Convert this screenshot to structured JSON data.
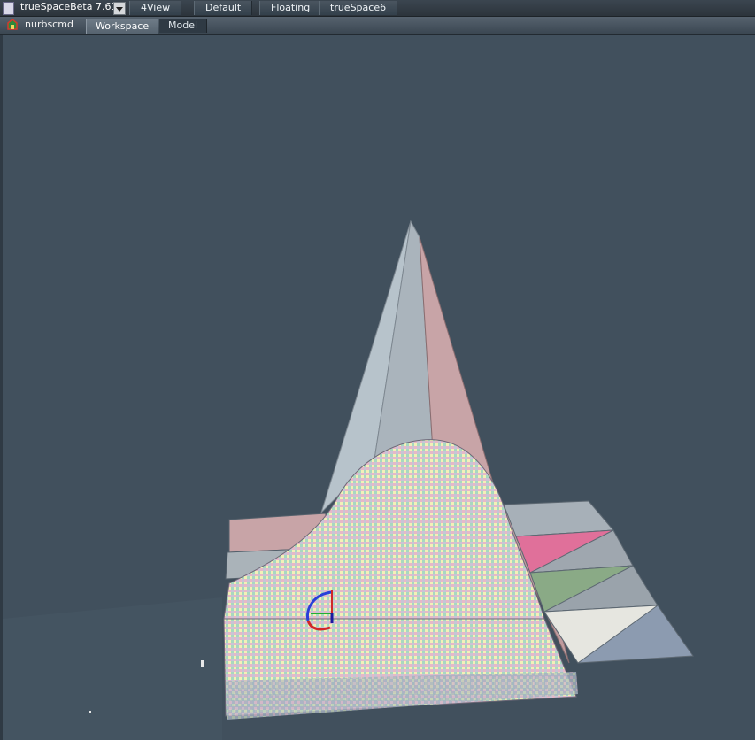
{
  "app": {
    "title": "trueSpaceBeta 7.61"
  },
  "layout_tabs": [
    "4View",
    "Default",
    "Floating",
    "trueSpace6"
  ],
  "node": {
    "label": "nurbscmd"
  },
  "workspace_tabs": [
    {
      "label": "Workspace",
      "active": true
    },
    {
      "label": "Model",
      "active": false
    }
  ],
  "viewport": {
    "background": "#41505d",
    "scene": "nurbs-surface-with-cone-and-checker-grid"
  },
  "colors": {
    "cone_left": "#b7c3cb",
    "cone_right": "#c8a4a7",
    "tile_pink": "#e0709a",
    "tile_green": "#8aaa86",
    "tile_white": "#e6e6e0",
    "tile_blue": "#8c9bb0"
  }
}
